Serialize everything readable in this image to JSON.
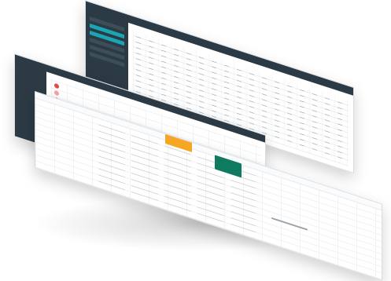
{
  "scene": {
    "description_hidden": "",
    "colors": {
      "sidebar": "#2b3a44",
      "accent_teal": "#19a7b6",
      "booking_orange": "#f5a623",
      "booking_purple": "#5c2d91",
      "booking_green": "#0e7a5f",
      "legend_red": "#e04a4a",
      "legend_pink": "#f2a1a1"
    }
  },
  "panels": {
    "top": {
      "sidebar_items": 6,
      "active_items": 2
    },
    "middle": {
      "room_thumbnails": 3
    },
    "front": {
      "blocks": [
        "orange",
        "purple",
        "green"
      ]
    }
  },
  "icons": [
    "logo-icon",
    "menu-icon",
    "calendar-icon"
  ]
}
